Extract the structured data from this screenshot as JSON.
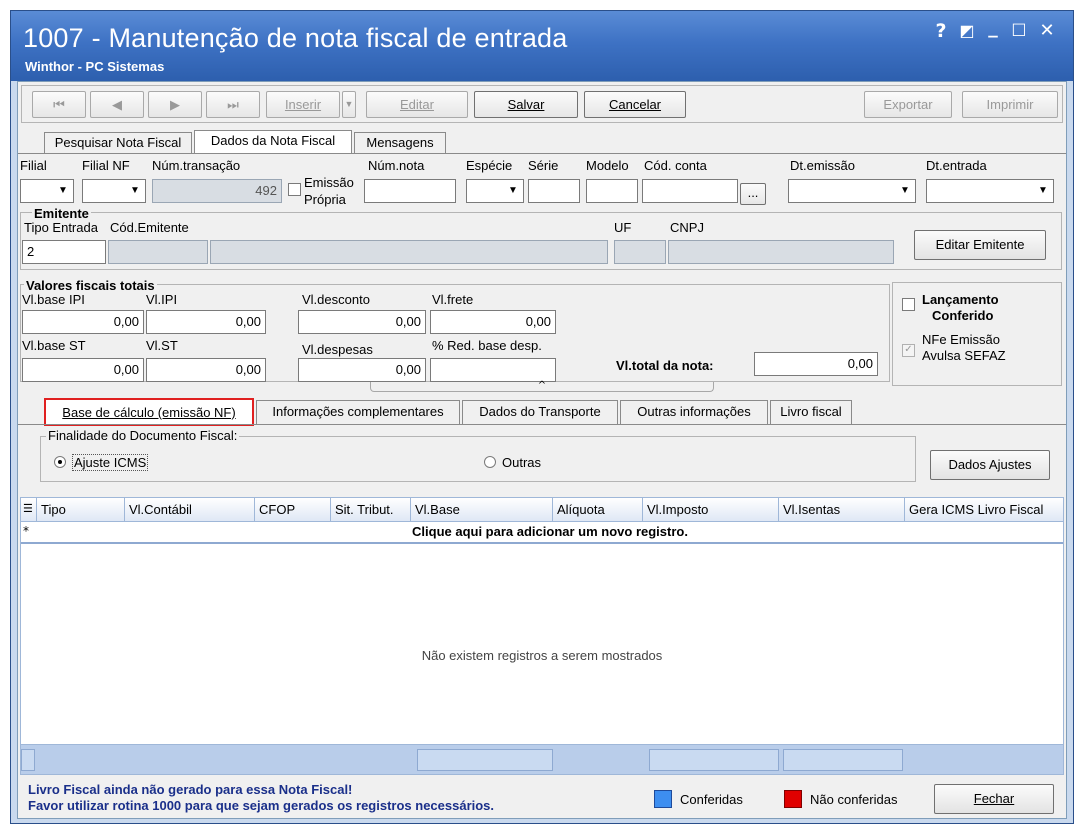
{
  "window": {
    "title": "1007 - Manutenção de nota fiscal de entrada",
    "subtitle": "Winthor - PC Sistemas",
    "controls": [
      "?",
      "🗕",
      "_",
      "☐",
      "✕"
    ]
  },
  "toolbar": {
    "first": "⏮",
    "prev": "◀",
    "next": "▶",
    "last": "⏭",
    "insert": "Inserir",
    "dropdown": "▼",
    "edit": "Editar",
    "save": "Salvar",
    "cancel": "Cancelar",
    "export": "Exportar",
    "print": "Imprimir"
  },
  "top_tabs": [
    "Pesquisar Nota Fiscal",
    "Dados da Nota Fiscal",
    "Mensagens"
  ],
  "header_fields": {
    "filial_label": "Filial",
    "filial_nf_label": "Filial NF",
    "num_transacao_label": "Núm.transação",
    "num_transacao_value": "492",
    "emissao_propria_label1": "Emissão",
    "emissao_propria_label2": "Própria",
    "num_nota_label": "Núm.nota",
    "especie_label": "Espécie",
    "serie_label": "Série",
    "modelo_label": "Modelo",
    "cod_conta_label": "Cód. conta",
    "cod_conta_button": "...",
    "dt_emissao_label": "Dt.emissão",
    "dt_entrada_label": "Dt.entrada"
  },
  "emitente": {
    "group_title": "Emitente",
    "tipo_entrada_label": "Tipo Entrada",
    "tipo_entrada_value": "2",
    "cod_emitente_label": "Cód.Emitente",
    "uf_label": "UF",
    "cnpj_label": "CNPJ",
    "edit_button": "Editar Emitente"
  },
  "valores": {
    "group_title": "Valores fiscais totais",
    "vl_base_ipi_label": "Vl.base IPI",
    "vl_base_ipi_value": "0,00",
    "vl_ipi_label": "Vl.IPI",
    "vl_ipi_value": "0,00",
    "vl_desconto_label": "Vl.desconto",
    "vl_desconto_value": "0,00",
    "vl_frete_label": "Vl.frete",
    "vl_frete_value": "0,00",
    "vl_base_st_label": "Vl.base ST",
    "vl_base_st_value": "0,00",
    "vl_st_label": "Vl.ST",
    "vl_st_value": "0,00",
    "vl_despesas_label": "Vl.despesas",
    "vl_despesas_value": "0,00",
    "red_base_desp_label": "% Red. base desp.",
    "red_base_desp_value": "",
    "vl_total_label": "Vl.total da nota:",
    "vl_total_value": "0,00"
  },
  "side_checks": {
    "lancamento_label1": "Lançamento",
    "lancamento_label2": "Conferido",
    "nfe_label1": "NFe Emissão",
    "nfe_label2": "Avulsa SEFAZ"
  },
  "splitter": "^",
  "bottom_tabs": [
    "Base de cálculo (emissão NF)",
    "Informações complementares",
    "Dados do Transporte",
    "Outras informações",
    "Livro fiscal"
  ],
  "finalidade": {
    "group_title": "Finalidade do Documento Fiscal:",
    "option1": "Ajuste ICMS",
    "option2": "Outras",
    "ajustes_button": "Dados Ajustes"
  },
  "grid": {
    "columns": [
      "Tipo",
      "Vl.Contábil",
      "CFOP",
      "Sit. Tribut.",
      "Vl.Base",
      "Alíquota",
      "Vl.Imposto",
      "Vl.Isentas",
      "Gera ICMS Livro Fiscal"
    ],
    "new_row_marker": "*",
    "new_row_text": "Clique aqui para adicionar um novo registro.",
    "empty_text": "Não existem registros a serem mostrados"
  },
  "status": {
    "message1": "Livro Fiscal ainda não gerado para essa Nota Fiscal!",
    "message2": "Favor utilizar rotina 1000 para que sejam gerados os registros necessários.",
    "legend_confirmed": "Conferidas",
    "legend_unconfirmed": "Não conferidas",
    "close_button": "Fechar"
  },
  "colors": {
    "title_bar": "#3e72c4",
    "highlight": "#e02020",
    "confirmed": "#3d8ef0",
    "unconfirmed": "#e00000",
    "status_text": "#1a2f8a"
  }
}
